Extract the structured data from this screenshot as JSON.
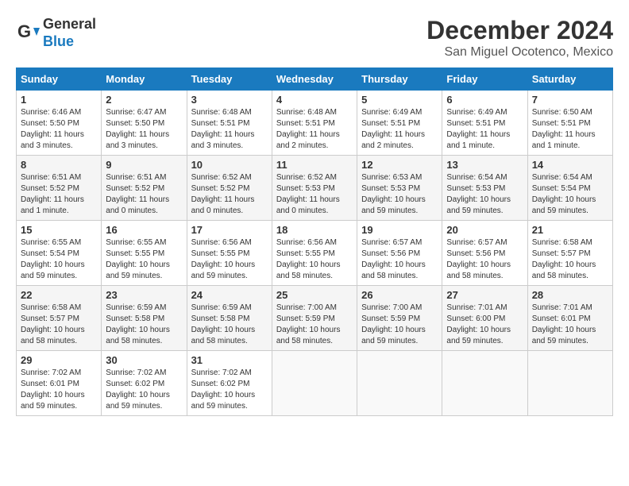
{
  "header": {
    "logo_line1": "General",
    "logo_line2": "Blue",
    "month": "December 2024",
    "location": "San Miguel Ocotenco, Mexico"
  },
  "columns": [
    "Sunday",
    "Monday",
    "Tuesday",
    "Wednesday",
    "Thursday",
    "Friday",
    "Saturday"
  ],
  "weeks": [
    [
      {
        "day": "1",
        "rise": "Sunrise: 6:46 AM",
        "set": "Sunset: 5:50 PM",
        "daylight": "Daylight: 11 hours and 3 minutes."
      },
      {
        "day": "2",
        "rise": "Sunrise: 6:47 AM",
        "set": "Sunset: 5:50 PM",
        "daylight": "Daylight: 11 hours and 3 minutes."
      },
      {
        "day": "3",
        "rise": "Sunrise: 6:48 AM",
        "set": "Sunset: 5:51 PM",
        "daylight": "Daylight: 11 hours and 3 minutes."
      },
      {
        "day": "4",
        "rise": "Sunrise: 6:48 AM",
        "set": "Sunset: 5:51 PM",
        "daylight": "Daylight: 11 hours and 2 minutes."
      },
      {
        "day": "5",
        "rise": "Sunrise: 6:49 AM",
        "set": "Sunset: 5:51 PM",
        "daylight": "Daylight: 11 hours and 2 minutes."
      },
      {
        "day": "6",
        "rise": "Sunrise: 6:49 AM",
        "set": "Sunset: 5:51 PM",
        "daylight": "Daylight: 11 hours and 1 minute."
      },
      {
        "day": "7",
        "rise": "Sunrise: 6:50 AM",
        "set": "Sunset: 5:51 PM",
        "daylight": "Daylight: 11 hours and 1 minute."
      }
    ],
    [
      {
        "day": "8",
        "rise": "Sunrise: 6:51 AM",
        "set": "Sunset: 5:52 PM",
        "daylight": "Daylight: 11 hours and 1 minute."
      },
      {
        "day": "9",
        "rise": "Sunrise: 6:51 AM",
        "set": "Sunset: 5:52 PM",
        "daylight": "Daylight: 11 hours and 0 minutes."
      },
      {
        "day": "10",
        "rise": "Sunrise: 6:52 AM",
        "set": "Sunset: 5:52 PM",
        "daylight": "Daylight: 11 hours and 0 minutes."
      },
      {
        "day": "11",
        "rise": "Sunrise: 6:52 AM",
        "set": "Sunset: 5:53 PM",
        "daylight": "Daylight: 11 hours and 0 minutes."
      },
      {
        "day": "12",
        "rise": "Sunrise: 6:53 AM",
        "set": "Sunset: 5:53 PM",
        "daylight": "Daylight: 10 hours and 59 minutes."
      },
      {
        "day": "13",
        "rise": "Sunrise: 6:54 AM",
        "set": "Sunset: 5:53 PM",
        "daylight": "Daylight: 10 hours and 59 minutes."
      },
      {
        "day": "14",
        "rise": "Sunrise: 6:54 AM",
        "set": "Sunset: 5:54 PM",
        "daylight": "Daylight: 10 hours and 59 minutes."
      }
    ],
    [
      {
        "day": "15",
        "rise": "Sunrise: 6:55 AM",
        "set": "Sunset: 5:54 PM",
        "daylight": "Daylight: 10 hours and 59 minutes."
      },
      {
        "day": "16",
        "rise": "Sunrise: 6:55 AM",
        "set": "Sunset: 5:55 PM",
        "daylight": "Daylight: 10 hours and 59 minutes."
      },
      {
        "day": "17",
        "rise": "Sunrise: 6:56 AM",
        "set": "Sunset: 5:55 PM",
        "daylight": "Daylight: 10 hours and 59 minutes."
      },
      {
        "day": "18",
        "rise": "Sunrise: 6:56 AM",
        "set": "Sunset: 5:55 PM",
        "daylight": "Daylight: 10 hours and 58 minutes."
      },
      {
        "day": "19",
        "rise": "Sunrise: 6:57 AM",
        "set": "Sunset: 5:56 PM",
        "daylight": "Daylight: 10 hours and 58 minutes."
      },
      {
        "day": "20",
        "rise": "Sunrise: 6:57 AM",
        "set": "Sunset: 5:56 PM",
        "daylight": "Daylight: 10 hours and 58 minutes."
      },
      {
        "day": "21",
        "rise": "Sunrise: 6:58 AM",
        "set": "Sunset: 5:57 PM",
        "daylight": "Daylight: 10 hours and 58 minutes."
      }
    ],
    [
      {
        "day": "22",
        "rise": "Sunrise: 6:58 AM",
        "set": "Sunset: 5:57 PM",
        "daylight": "Daylight: 10 hours and 58 minutes."
      },
      {
        "day": "23",
        "rise": "Sunrise: 6:59 AM",
        "set": "Sunset: 5:58 PM",
        "daylight": "Daylight: 10 hours and 58 minutes."
      },
      {
        "day": "24",
        "rise": "Sunrise: 6:59 AM",
        "set": "Sunset: 5:58 PM",
        "daylight": "Daylight: 10 hours and 58 minutes."
      },
      {
        "day": "25",
        "rise": "Sunrise: 7:00 AM",
        "set": "Sunset: 5:59 PM",
        "daylight": "Daylight: 10 hours and 58 minutes."
      },
      {
        "day": "26",
        "rise": "Sunrise: 7:00 AM",
        "set": "Sunset: 5:59 PM",
        "daylight": "Daylight: 10 hours and 59 minutes."
      },
      {
        "day": "27",
        "rise": "Sunrise: 7:01 AM",
        "set": "Sunset: 6:00 PM",
        "daylight": "Daylight: 10 hours and 59 minutes."
      },
      {
        "day": "28",
        "rise": "Sunrise: 7:01 AM",
        "set": "Sunset: 6:01 PM",
        "daylight": "Daylight: 10 hours and 59 minutes."
      }
    ],
    [
      {
        "day": "29",
        "rise": "Sunrise: 7:02 AM",
        "set": "Sunset: 6:01 PM",
        "daylight": "Daylight: 10 hours and 59 minutes."
      },
      {
        "day": "30",
        "rise": "Sunrise: 7:02 AM",
        "set": "Sunset: 6:02 PM",
        "daylight": "Daylight: 10 hours and 59 minutes."
      },
      {
        "day": "31",
        "rise": "Sunrise: 7:02 AM",
        "set": "Sunset: 6:02 PM",
        "daylight": "Daylight: 10 hours and 59 minutes."
      },
      null,
      null,
      null,
      null
    ]
  ]
}
